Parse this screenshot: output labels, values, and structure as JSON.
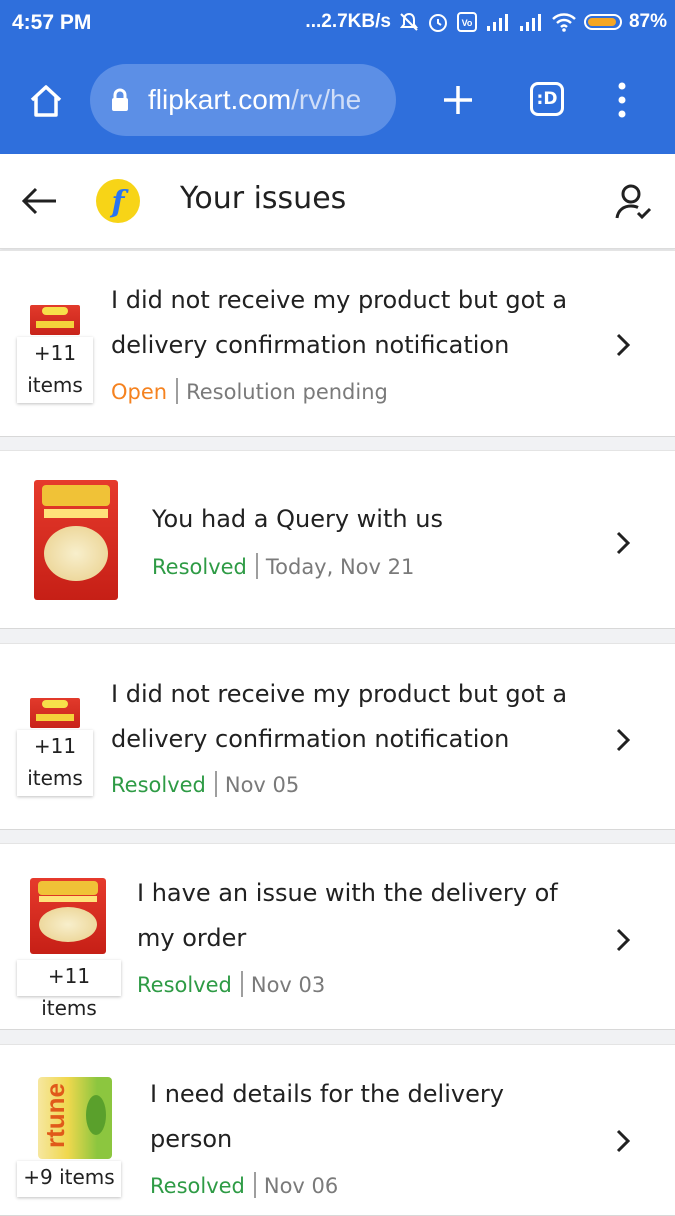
{
  "status_bar": {
    "time": "4:57 PM",
    "net_speed": "...2.7KB/s",
    "battery": "87%",
    "colors": {
      "background": "#2f6fdc",
      "battery_fill": "#f5a623"
    }
  },
  "browser": {
    "url_host": "flipkart.com",
    "url_path": "/rv/he",
    "tabs_label": ":D"
  },
  "header": {
    "title": "Your issues",
    "logo_letter": "f"
  },
  "issues": [
    {
      "title_line1": "I did not receive my product but got a",
      "title_line2": "delivery confirmation notification",
      "status": "Open",
      "detail": "Resolution pending",
      "count_line1": "+11",
      "count_line2": "items"
    },
    {
      "title_line1": "You had a Query with us",
      "status": "Resolved",
      "detail": "Today, Nov 21"
    },
    {
      "title_line1": "I did not receive my product but got a",
      "title_line2": "delivery confirmation notification",
      "status": "Resolved",
      "detail": "Nov 05",
      "count_line1": "+11",
      "count_line2": "items"
    },
    {
      "title_line1": "I have an issue with the delivery of",
      "title_line2": "my order",
      "status": "Resolved",
      "detail": "Nov 03",
      "count": "+11 items"
    },
    {
      "title_line1": "I need details for the delivery",
      "title_line2": "person",
      "status": "Resolved",
      "detail": "Nov 06",
      "count": "+9 items"
    }
  ],
  "colors": {
    "open": "#f5821f",
    "resolved": "#2e9b45",
    "brand_blue": "#2874f0",
    "brand_yellow": "#f7d417"
  }
}
